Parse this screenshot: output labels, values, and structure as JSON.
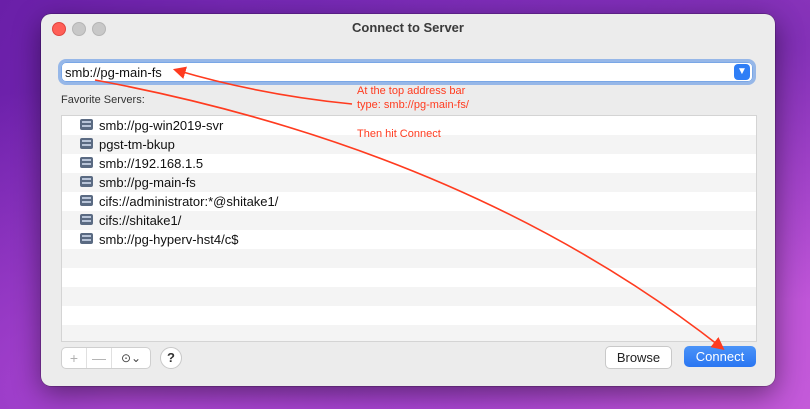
{
  "window": {
    "title": "Connect to Server"
  },
  "address_bar": {
    "value": "smb://pg-main-fs",
    "dropdown_icon": "chevron-down-icon"
  },
  "favorites": {
    "label": "Favorite Servers:",
    "items": [
      {
        "label": "smb://pg-win2019-svr",
        "icon": "server-icon"
      },
      {
        "label": "pgst-tm-bkup",
        "icon": "server-icon"
      },
      {
        "label": "smb://192.168.1.5",
        "icon": "server-icon"
      },
      {
        "label": "smb://pg-main-fs",
        "icon": "server-icon"
      },
      {
        "label": "cifs://administrator:*@shitake1/",
        "icon": "server-icon"
      },
      {
        "label": "cifs://shitake1/",
        "icon": "server-icon"
      },
      {
        "label": "smb://pg-hyperv-hst4/c$",
        "icon": "server-icon"
      }
    ]
  },
  "toolbar": {
    "add_label": "+",
    "remove_label": "—",
    "more_label": "⊙⌄",
    "help_label": "?",
    "browse_label": "Browse",
    "connect_label": "Connect"
  },
  "annotation": {
    "line1": "At the top address bar",
    "line2": "type:  smb://pg-main-fs/",
    "line3": "Then hit Connect",
    "color": "#ff3b1f"
  },
  "colors": {
    "accent": "#2f7ef6",
    "annotation": "#ff3b1f"
  }
}
